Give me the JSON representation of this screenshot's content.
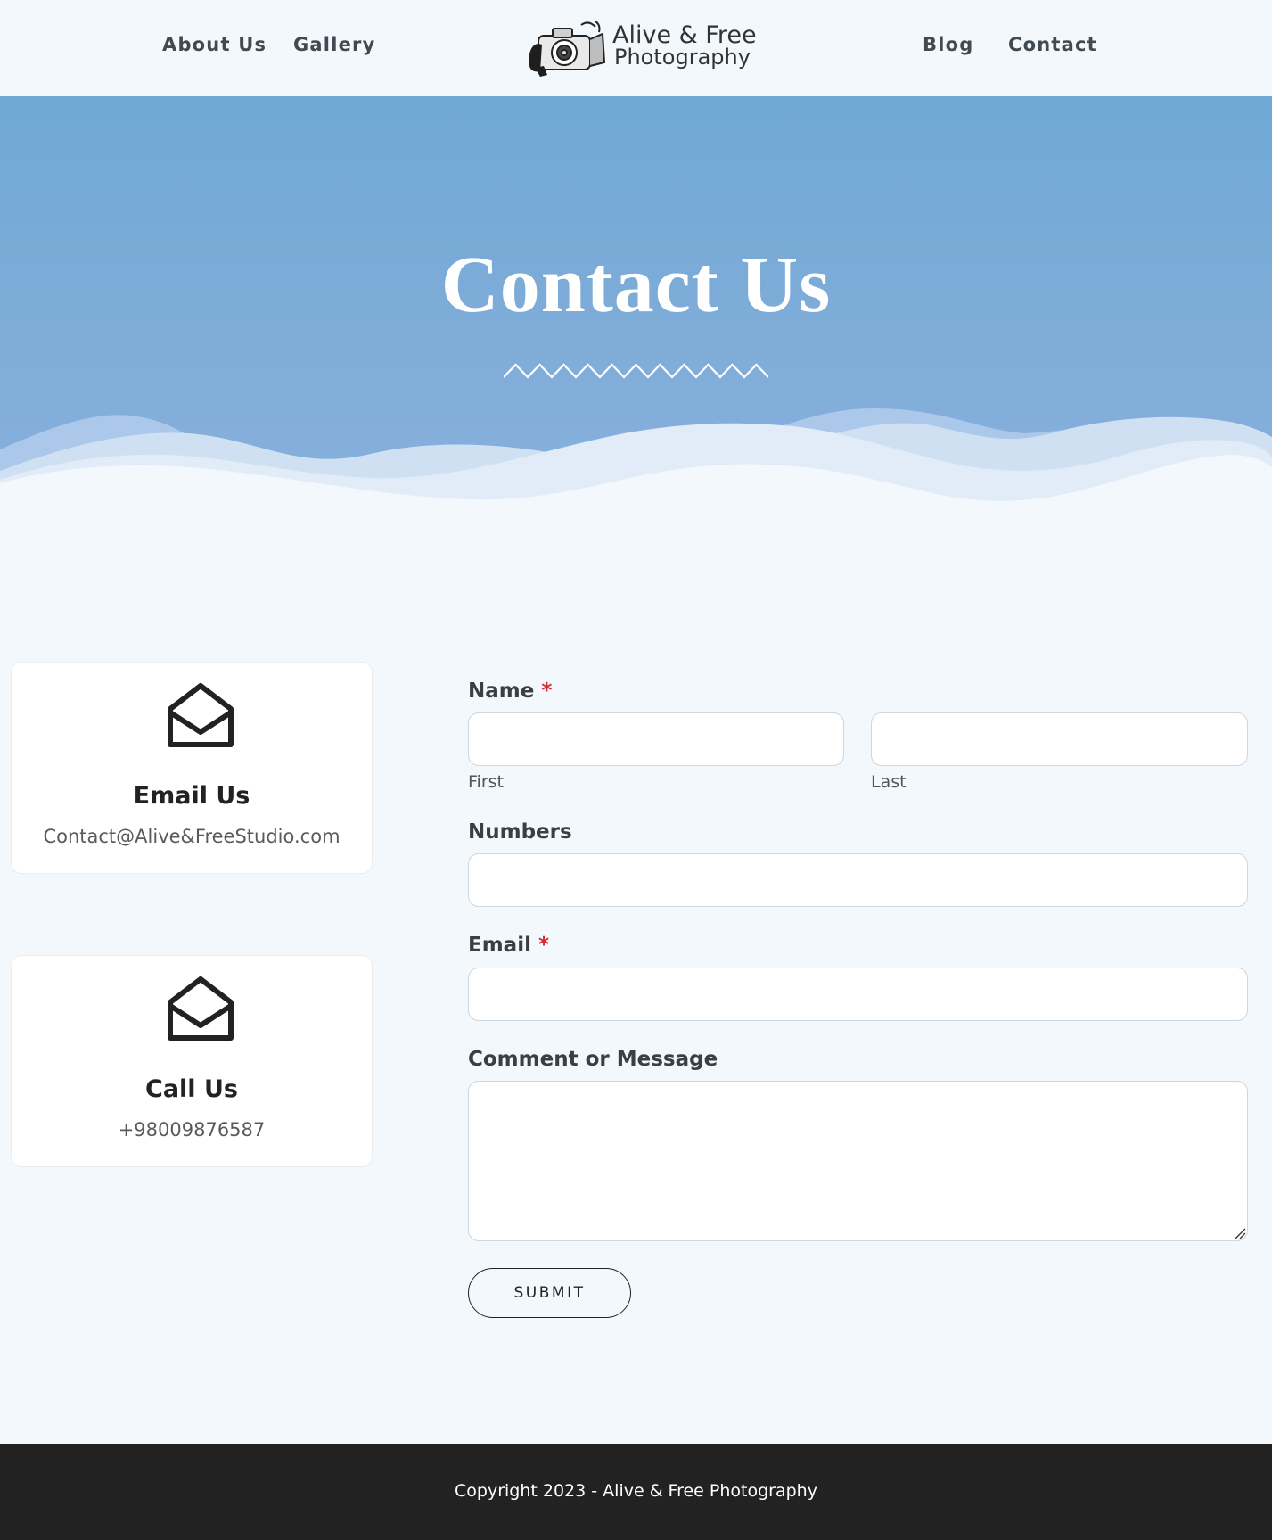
{
  "header": {
    "nav_left": [
      {
        "label": "About Us"
      },
      {
        "label": "Gallery"
      }
    ],
    "nav_right": [
      {
        "label": "Blog"
      },
      {
        "label": "Contact"
      }
    ],
    "logo": {
      "line1": "Alive & Free",
      "line2": "Photography",
      "icon": "camera-logo-icon"
    }
  },
  "hero": {
    "title": "Contact Us"
  },
  "cards": [
    {
      "title": "Email Us",
      "text": "Contact@Alive&FreeStudio.com",
      "icon": "envelope-open-icon"
    },
    {
      "title": "Call Us",
      "text": "+98009876587",
      "icon": "envelope-open-icon"
    }
  ],
  "form": {
    "name": {
      "label": "Name",
      "required": "*",
      "first_value": "",
      "last_value": "",
      "first_sublabel": "First",
      "last_sublabel": "Last"
    },
    "numbers": {
      "label": "Numbers",
      "value": ""
    },
    "email": {
      "label": "Email",
      "required": "*",
      "value": ""
    },
    "message": {
      "label": "Comment or Message",
      "value": ""
    },
    "submit_label": "SUBMIT"
  },
  "footer": {
    "copyright": "Copyright 2023 - Alive & Free Photography"
  },
  "colors": {
    "hero_top": "#6fa9d4",
    "hero_bottom": "#88b2de",
    "page_background": "#f2f8fc",
    "footer_background": "#222222",
    "required_star": "#d6292f"
  }
}
